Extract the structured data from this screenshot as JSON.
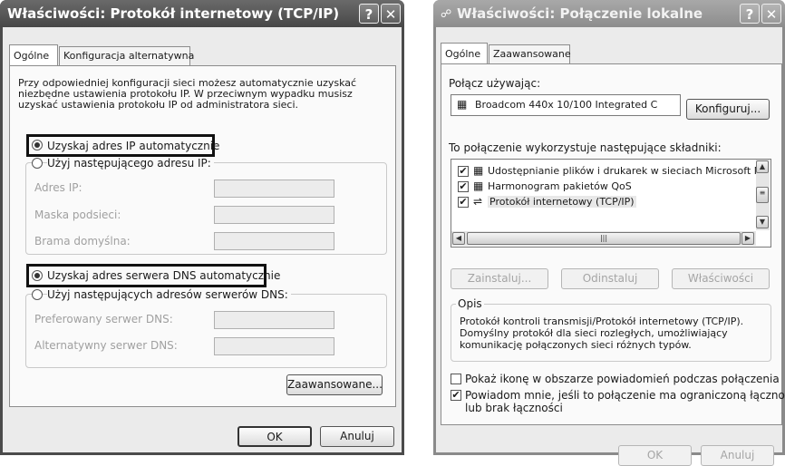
{
  "left": {
    "title": "Właściwości: Protokół internetowy (TCP/IP)",
    "help_icon": "?",
    "close_icon": "✕",
    "tabs": [
      "Ogólne",
      "Konfiguracja alternatywna"
    ],
    "description": [
      "Przy odpowiedniej konfiguracji sieci możesz automatycznie uzyskać",
      "niezbędne ustawienia protokołu IP. W przeciwnym wypadku musisz",
      "uzyskać ustawienia protokołu IP od administratora sieci."
    ],
    "radio_ip_auto": "Uzyskaj adres IP automatycznie",
    "radio_ip_manual": "Użyj następującego adresu IP:",
    "ip_fields": [
      "Adres IP:",
      "Maska podsieci:",
      "Brama domyślna:"
    ],
    "radio_dns_auto": "Uzyskaj adres serwera DNS automatycznie",
    "radio_dns_manual": "Użyj następujących adresów serwerów DNS:",
    "dns_fields": [
      "Preferowany serwer DNS:",
      "Alternatywny serwer DNS:"
    ],
    "ip_dots": ".",
    "advanced_button": "Zaawansowane...",
    "ok_button": "OK",
    "cancel_button": "Anuluj"
  },
  "right": {
    "title": "Właściwości: Połączenie lokalne",
    "help_icon": "?",
    "close_icon": "✕",
    "tabs": [
      "Ogólne",
      "Zaawansowane"
    ],
    "connect_using_label": "Połącz używając:",
    "adapter_name": "Broadcom 440x 10/100 Integrated C",
    "configure_button": "Konfiguruj...",
    "components_label": "To połączenie wykorzystuje następujące składniki:",
    "components": [
      "Udostępnianie plików i drukarek w sieciach Microsoft N",
      "Harmonogram pakietów QoS",
      "Protokół internetowy (TCP/IP)"
    ],
    "install_button": "Zainstaluj...",
    "uninstall_button": "Odinstaluj",
    "properties_button": "Właściwości",
    "description_group": "Opis",
    "description": [
      "Protokół kontroli transmisji/Protokół internetowy (TCP/IP).",
      "Domyślny protokół dla sieci rozległych, umożliwiający",
      "komunikację połączonych sieci różnych typów."
    ],
    "show_icon_checkbox": "Pokaż ikonę w obszarze powiadomień podczas połączenia",
    "notify_checkbox_line1": "Powiadom mnie, jeśli to połączenie ma ograniczoną łączność",
    "notify_checkbox_line2": "lub brak łączności",
    "ok_button": "OK",
    "cancel_button": "Anuluj"
  },
  "check_mark": "✔",
  "network_icon": "☍",
  "protocol_icon": "⇌",
  "adapter_icon": "▦"
}
